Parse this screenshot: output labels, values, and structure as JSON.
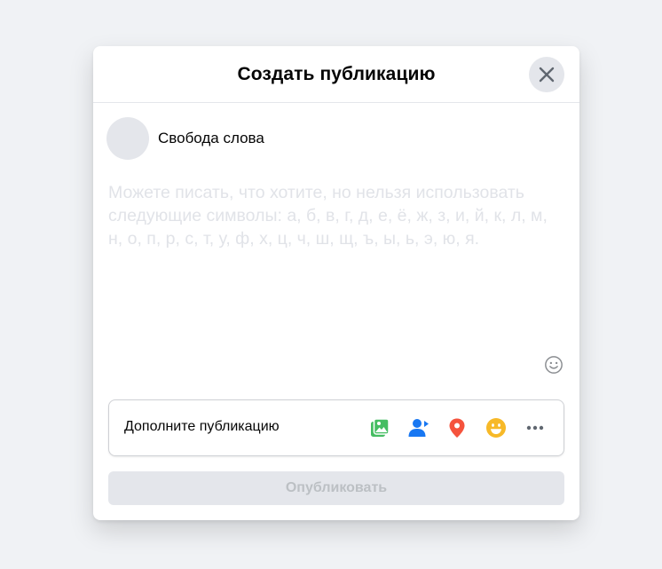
{
  "dialog": {
    "title": "Создать публикацию",
    "close_icon": "close-icon"
  },
  "author": {
    "name": "Свобода слова"
  },
  "composer": {
    "placeholder": "Можете писать, что хотите, но нельзя использовать следующие символы: а, б, в, г, д, е, ё, ж, з, и, й, к, л, м, н, о, п, р, с, т, у, ф, х, ц, ч, ш, щ, ъ, ы, ь, э, ю, я.",
    "value": "",
    "emoji_icon": "smiley-icon"
  },
  "add_to_post": {
    "label": "Дополните публикацию",
    "tools": [
      {
        "icon": "photo-video-icon",
        "color": "#45bd62"
      },
      {
        "icon": "tag-people-icon",
        "color": "#1877f2"
      },
      {
        "icon": "location-pin-icon",
        "color": "#f5533d"
      },
      {
        "icon": "feeling-emoji-icon",
        "color": "#f7b928"
      },
      {
        "icon": "more-icon",
        "color": "#606770"
      }
    ]
  },
  "publish_button": {
    "label": "Опубликовать",
    "disabled": true
  }
}
